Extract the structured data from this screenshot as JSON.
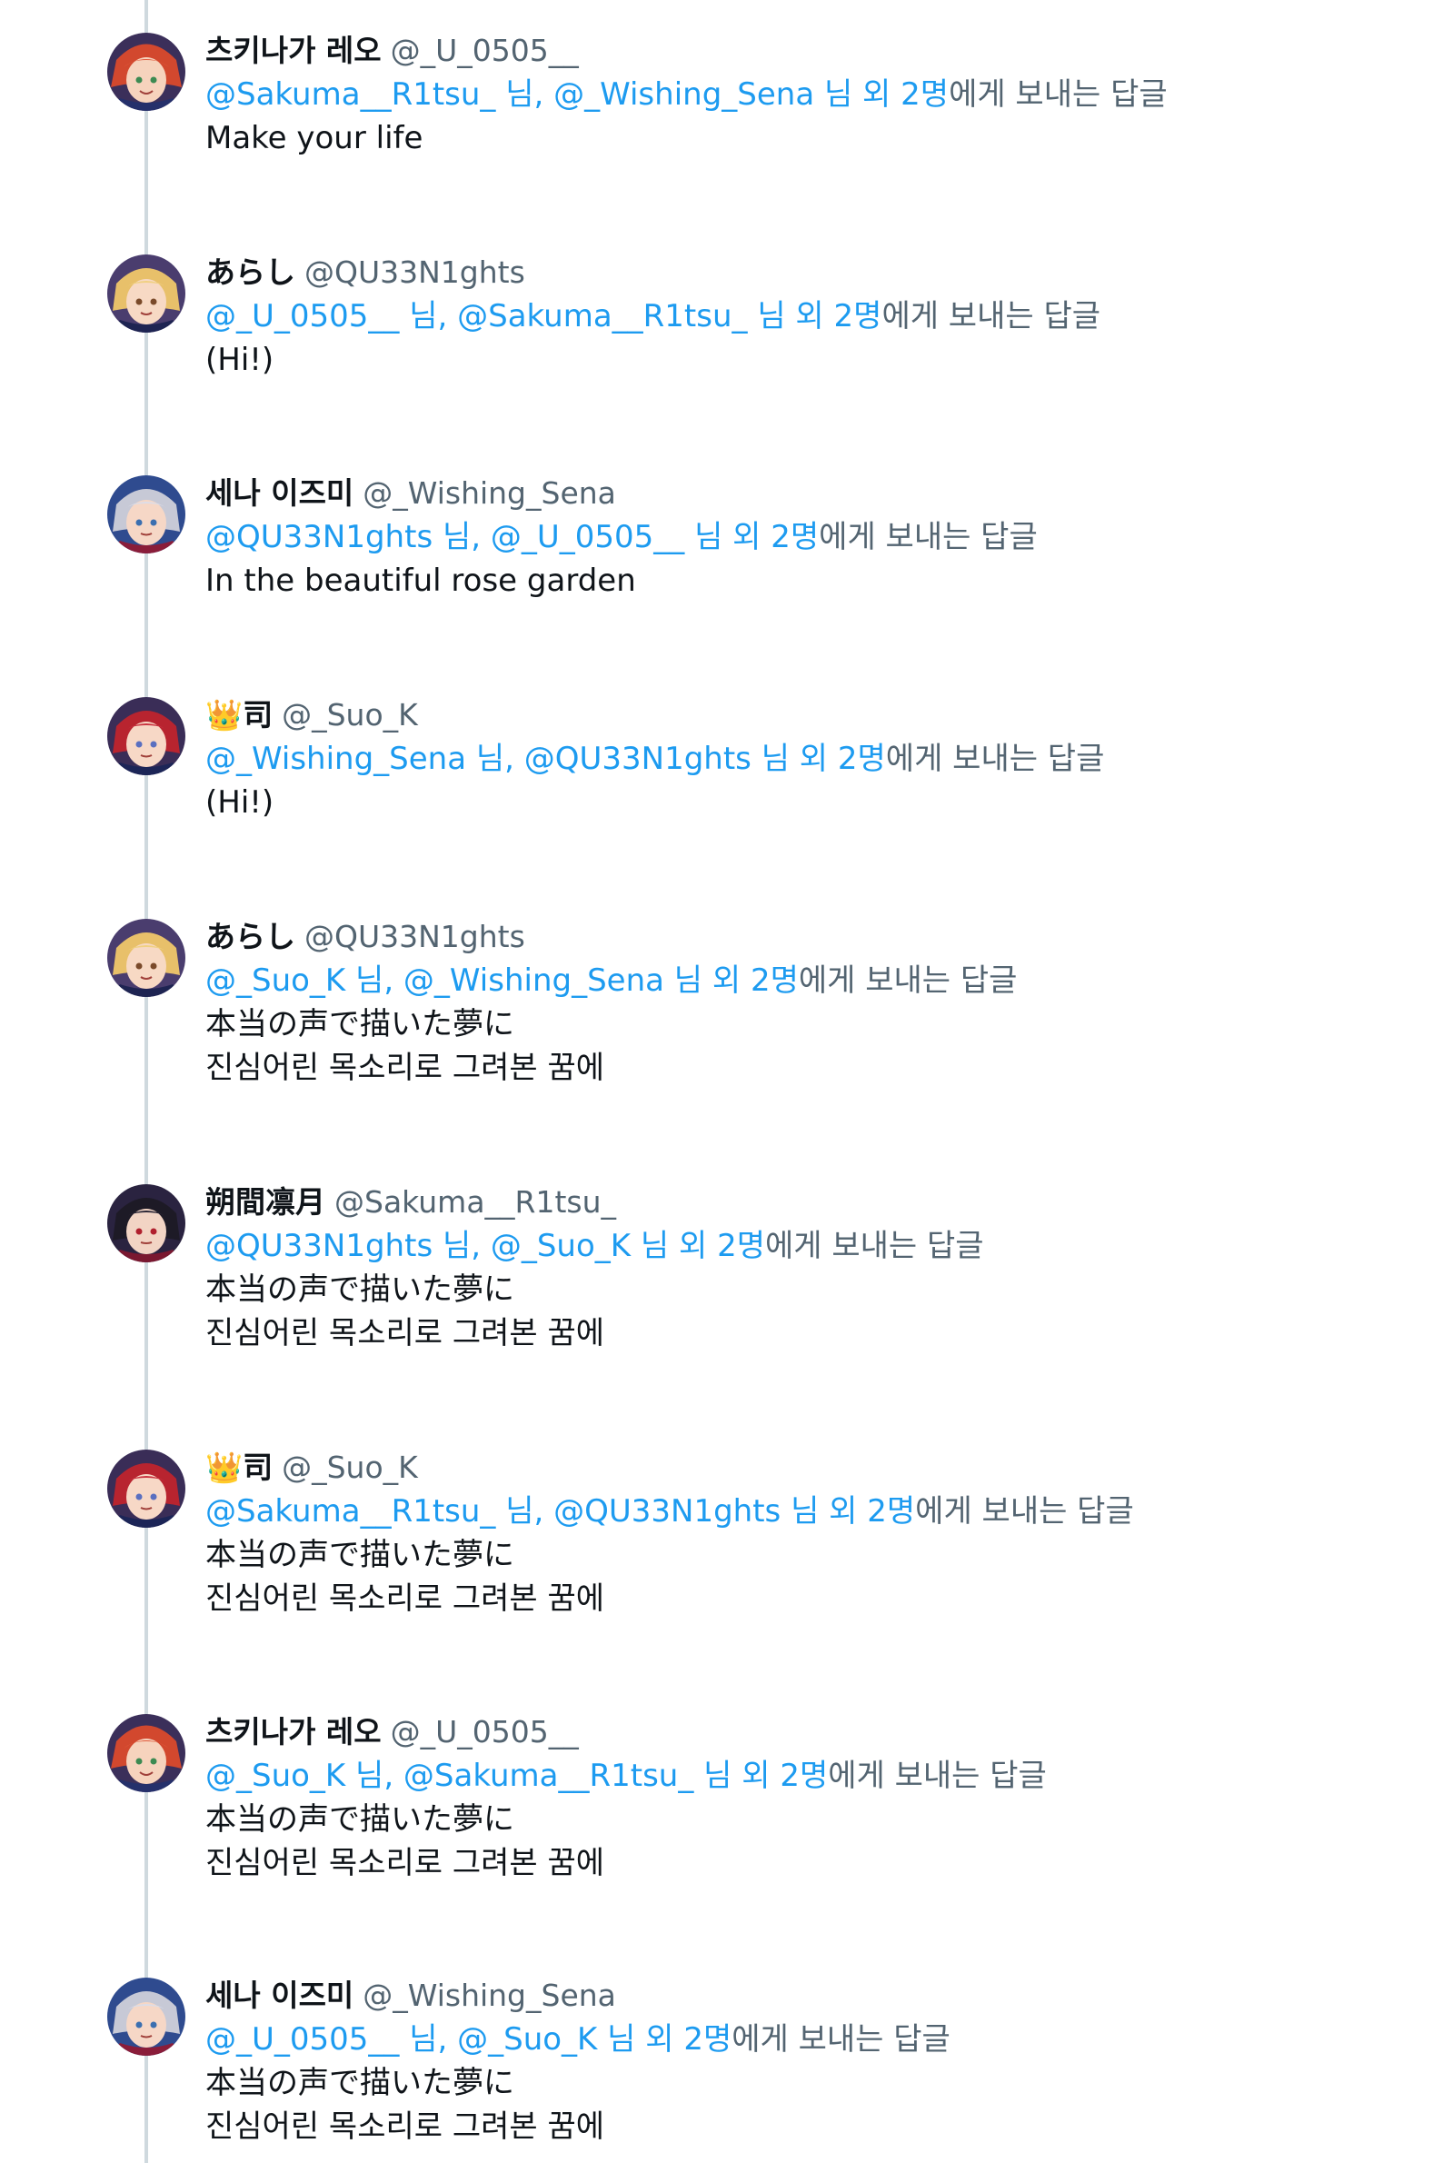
{
  "colors": {
    "accent": "#1d9bf0",
    "secondary_text": "#536471",
    "primary_text": "#0f1419",
    "thread_line": "#cfd9de"
  },
  "tweets": [
    {
      "name": "츠키나가 레오",
      "handle": "@_U_0505__",
      "reply_mentions": "@Sakuma__R1tsu_ 님, @_Wishing_Sena 님 외 2명",
      "reply_suffix": "에게 보내는 답글",
      "lines": [
        "Make your life"
      ],
      "avatar": "avatar-orange-hair"
    },
    {
      "name": "あらし",
      "handle": "@QU33N1ghts",
      "reply_mentions": "@_U_0505__ 님, @Sakuma__R1tsu_ 님 외 2명",
      "reply_suffix": "에게 보내는 답글",
      "lines": [
        "(Hi!)"
      ],
      "avatar": "avatar-blonde-hair"
    },
    {
      "name": "세나 이즈미",
      "handle": "@_Wishing_Sena",
      "reply_mentions": "@QU33N1ghts 님, @_U_0505__ 님 외 2명",
      "reply_suffix": "에게 보내는 답글",
      "lines": [
        "In the beautiful rose garden"
      ],
      "avatar": "avatar-silver-hair"
    },
    {
      "name": "司",
      "crown": "👑",
      "handle": "@_Suo_K",
      "reply_mentions": "@_Wishing_Sena 님, @QU33N1ghts 님 외 2명",
      "reply_suffix": "에게 보내는 답글",
      "lines": [
        "(Hi!)"
      ],
      "avatar": "avatar-red-hair"
    },
    {
      "name": "あらし",
      "handle": "@QU33N1ghts",
      "reply_mentions": "@_Suo_K 님, @_Wishing_Sena 님 외 2명",
      "reply_suffix": "에게 보내는 답글",
      "lines": [
        "本当の声で描いた夢に",
        "진심어린 목소리로 그려본 꿈에"
      ],
      "avatar": "avatar-blonde-hair"
    },
    {
      "name": "朔間凛月",
      "handle": "@Sakuma__R1tsu_",
      "reply_mentions": "@QU33N1ghts 님, @_Suo_K 님 외 2명",
      "reply_suffix": "에게 보내는 답글",
      "lines": [
        "本当の声で描いた夢に",
        "진심어린 목소리로 그려본 꿈에"
      ],
      "avatar": "avatar-black-hair"
    },
    {
      "name": "司",
      "crown": "👑",
      "handle": "@_Suo_K",
      "reply_mentions": "@Sakuma__R1tsu_ 님, @QU33N1ghts 님 외 2명",
      "reply_suffix": "에게 보내는 답글",
      "lines": [
        "本当の声で描いた夢に",
        "진심어린 목소리로 그려본 꿈에"
      ],
      "avatar": "avatar-red-hair"
    },
    {
      "name": "츠키나가 레오",
      "handle": "@_U_0505__",
      "reply_mentions": "@_Suo_K 님, @Sakuma__R1tsu_ 님 외 2명",
      "reply_suffix": "에게 보내는 답글",
      "lines": [
        "本当の声で描いた夢に",
        "진심어린 목소리로 그려본 꿈에"
      ],
      "avatar": "avatar-orange-hair"
    },
    {
      "name": "세나 이즈미",
      "handle": "@_Wishing_Sena",
      "reply_mentions": "@_U_0505__ 님, @_Suo_K 님 외 2명",
      "reply_suffix": "에게 보내는 답글",
      "lines": [
        "本当の声で描いた夢に",
        "진심어린 목소리로 그려본 꿈에"
      ],
      "avatar": "avatar-silver-hair"
    }
  ]
}
